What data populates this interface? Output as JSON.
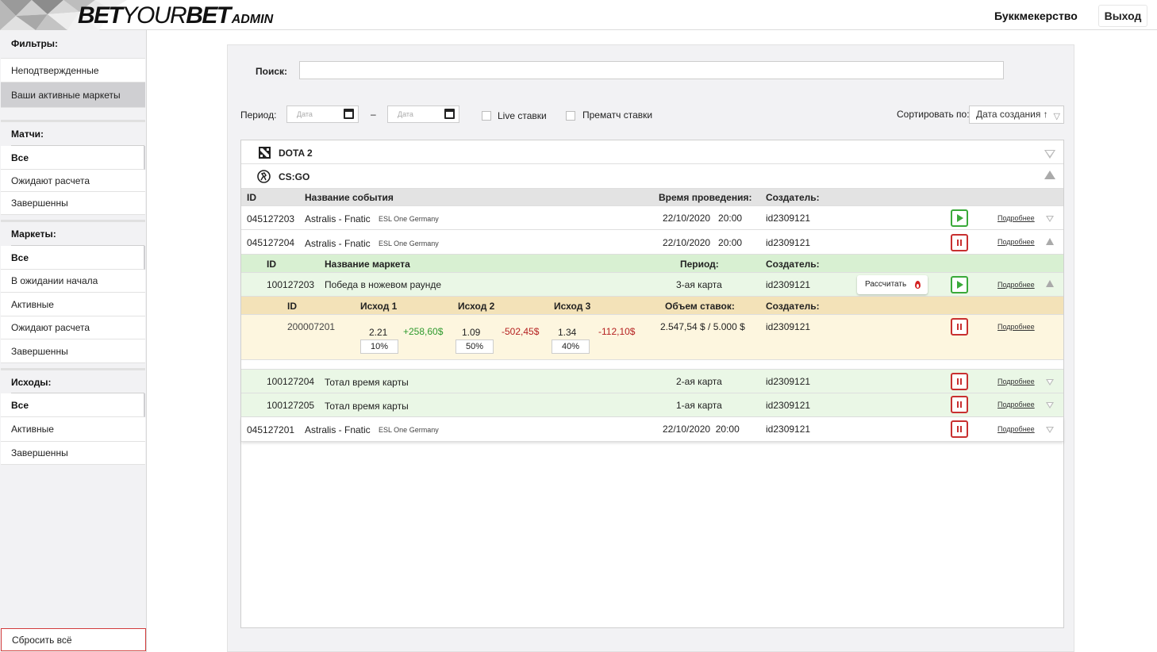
{
  "header": {
    "logo_bet": "BET",
    "logo_your": "YOUR",
    "logo_bet2": "BET",
    "logo_admin": "ADMIN",
    "bookmaker_link": "Буккмекерство",
    "logout_label": "Выход"
  },
  "sidebar": {
    "filters_title": "Фильтры:",
    "filter_unconfirmed": "Неподтвержденные",
    "filter_active_markets": "Ваши активные маркеты",
    "matches_title": "Матчи:",
    "matches_items": [
      "Все",
      "Ожидают расчета",
      "Завершенны"
    ],
    "markets_title": "Маркеты:",
    "markets_items": [
      "Все",
      "В ожидании начала",
      "Активные",
      "Ожидают расчета",
      "Завершенны"
    ],
    "outcomes_title": "Исходы:",
    "outcomes_items": [
      "Все",
      "Активные",
      "Завершенны"
    ],
    "reset_label": "Сбросить всё"
  },
  "toolbar": {
    "search_label": "Поиск:",
    "search_value": "",
    "period_label": "Период:",
    "date_from_placeholder": "Дата",
    "dash": "–",
    "date_to_placeholder": "Дата",
    "live_label": "Live ставки",
    "prematch_label": "Прематч ставки",
    "sort_label": "Сортировать по:",
    "sort_value": "Дата создания ↑"
  },
  "games": {
    "dota_label": "DOTA 2",
    "csgo_label": "CS:GO"
  },
  "events_header": {
    "id": "ID",
    "name": "Название события",
    "time": "Время проведения:",
    "creator": "Создатель:"
  },
  "events": [
    {
      "id": "045127203",
      "name": "Astralis - Fnatic",
      "tournament": "ESL One Germany",
      "datetime": "22/10/2020   20:00",
      "creator": "id2309121",
      "details": "Подробнее"
    },
    {
      "id": "045127204",
      "name": "Astralis - Fnatic",
      "tournament": "ESL One Germany",
      "datetime": "22/10/2020   20:00",
      "creator": "id2309121",
      "details": "Подробнее"
    },
    {
      "id": "045127201",
      "name": "Astralis - Fnatic",
      "tournament": "ESL One Germany",
      "datetime": "22/10/2020  20:00",
      "creator": "id2309121",
      "details": "Подробнее"
    }
  ],
  "markets_header": {
    "id": "ID",
    "name": "Название маркета",
    "period": "Период:",
    "creator": "Создатель:"
  },
  "markets": [
    {
      "id": "100127203",
      "name": "Победа в ножевом раунде",
      "period": "3-ая карта",
      "creator": "id2309121",
      "calc_label": "Рассчитать",
      "details": "Подробнее"
    },
    {
      "id": "100127204",
      "name": "Тотал время карты",
      "period": "2-ая карта",
      "creator": "id2309121",
      "details": "Подробнее"
    },
    {
      "id": "100127205",
      "name": "Тотал время карты",
      "period": "1-ая карта",
      "creator": "id2309121",
      "details": "Подробнее"
    }
  ],
  "outcomes_header": {
    "id": "ID",
    "o1": "Исход 1",
    "o2": "Исход 2",
    "o3": "Исход 3",
    "volume": "Объем ставок:",
    "creator": "Создатель:"
  },
  "outcome_row": {
    "id": "200007201",
    "o1_odds": "2.21",
    "o1_profit": "+258,60$",
    "o1_pct": "10%",
    "o2_odds": "1.09",
    "o2_profit": "-502,45$",
    "o2_pct": "50%",
    "o3_odds": "1.34",
    "o3_profit": "-112,10$",
    "o3_pct": "40%",
    "volume": "2.547,54 $ / 5.000 $",
    "creator": "id2309121",
    "details": "Подробнее"
  },
  "colors": {
    "market_green": "#eaf7e6",
    "market_header_green": "#d8f0d2",
    "outcome_yellow": "#fdf6df",
    "outcome_header_yellow": "#f3e2b8",
    "play_green": "#3aa93a",
    "pause_red": "#c83030"
  }
}
